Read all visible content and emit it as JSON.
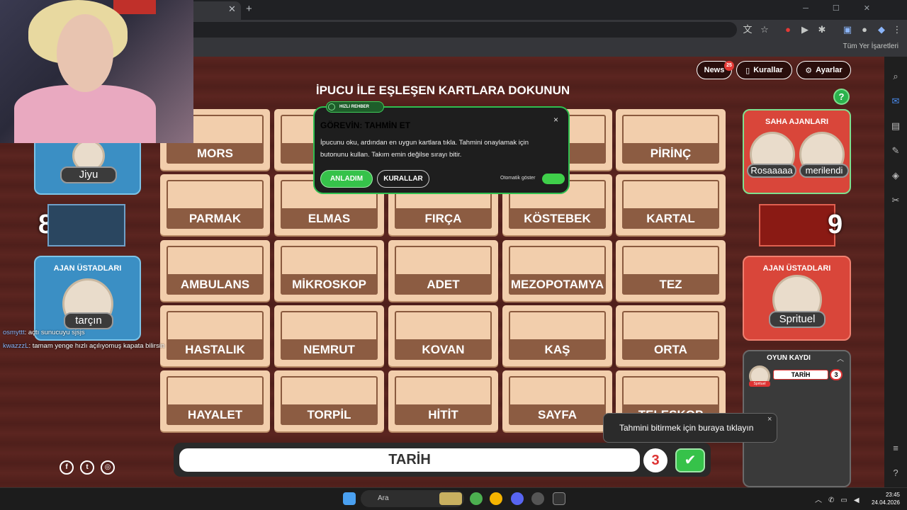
{
  "browser": {
    "bookmarks_label": "Tüm Yer İşaretleri"
  },
  "top_buttons": {
    "news": "News",
    "news_badge": "25",
    "rules": "Kurallar",
    "settings": "Ayarlar"
  },
  "headline": "İPUCU İLE EŞLEŞEN KARTLARA DOKUNUN",
  "help": "?",
  "board": [
    [
      "MORS",
      "D",
      "",
      "",
      "PİRİNÇ"
    ],
    [
      "PARMAK",
      "ELMAS",
      "FIRÇA",
      "KÖSTEBEK",
      "KARTAL"
    ],
    [
      "AMBULANS",
      "MİKROSKOP",
      "ADET",
      "MEZOPOTAMYA",
      "TEZ"
    ],
    [
      "HASTALIK",
      "NEMRUT",
      "KOVAN",
      "KAŞ",
      "ORTA"
    ],
    [
      "HAYALET",
      "TORPİL",
      "HİTİT",
      "SAYFA",
      "TELESKOP"
    ]
  ],
  "blue_team": {
    "agent_name": "Jiyu",
    "score": "8",
    "spymaster_title": "AJAN ÜSTADLARI",
    "spymaster_name": "tarçın"
  },
  "red_team": {
    "agents_title": "SAHA AJANLARI",
    "agent1": "Rosaaaaa",
    "agent2": "merilendi",
    "score": "9",
    "spymaster_title": "AJAN ÜSTADLARI",
    "spymaster_name": "Sprituel"
  },
  "popup": {
    "pill": "HIZLI REHBER",
    "title": "GÖREVİN: TAHMİN ET",
    "text": "İpucunu oku, ardından en uygun kartlara tıkla. Tahmini onaylamak için butonunu kullan. Takım emin değilse sırayı bitir.",
    "ok": "ANLADIM",
    "rules": "KURALLAR",
    "auto_show": "Otomatik göster",
    "close": "×"
  },
  "clue": {
    "word": "TARİH",
    "count": "3",
    "confirm_icon": "check-icon"
  },
  "tooltip": {
    "text": "Tahmini bitirmek için buraya tıklayın",
    "close": "×"
  },
  "game_log": {
    "title": "OYUN KAYDI",
    "entries": [
      {
        "player": "Sprituel",
        "word": "TARİH",
        "count": "3"
      }
    ]
  },
  "chat": [
    {
      "user": "osmyttt",
      "text": ": açtı sunucuyu sjsjs"
    },
    {
      "user": "kwazzzL",
      "text": ": tamam yenge hızlı açılıyomuş kapata bilirsin"
    }
  ],
  "taskbar": {
    "search": "Ara",
    "time": "23:45",
    "date": "24.04.2026"
  },
  "colors": {
    "green_accent": "#36c24a",
    "blue_team": "#3b8fc4",
    "red_team": "#d9463a",
    "card": "#f2ceac"
  }
}
